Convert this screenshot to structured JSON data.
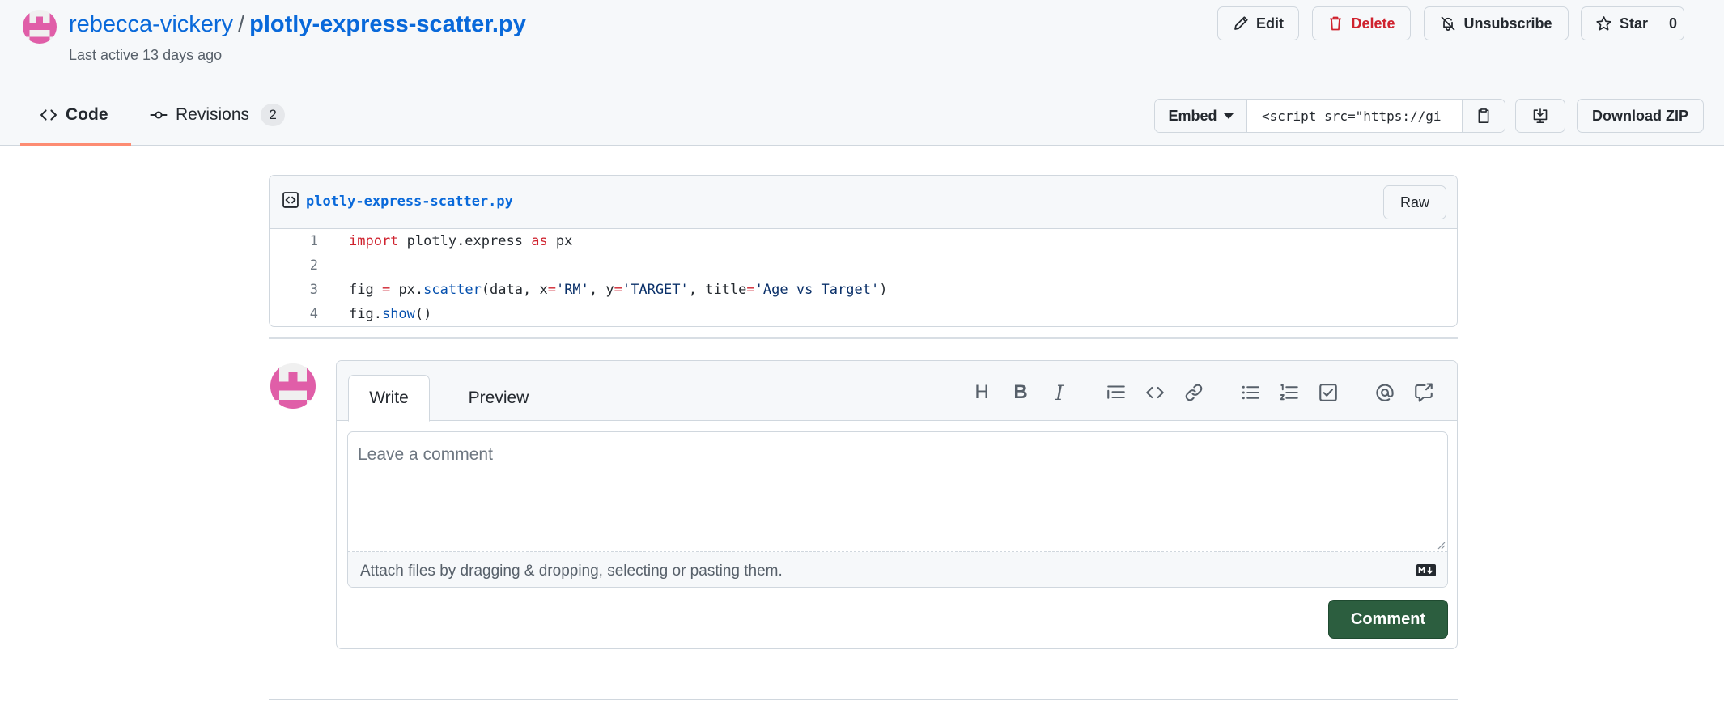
{
  "header": {
    "owner": "rebecca-vickery",
    "separator": "/",
    "gist_name": "plotly-express-scatter.py",
    "last_active": "Last active 13 days ago"
  },
  "actions": {
    "edit": "Edit",
    "delete": "Delete",
    "unsubscribe": "Unsubscribe",
    "star": "Star",
    "star_count": "0"
  },
  "tabs": {
    "code": "Code",
    "revisions": "Revisions",
    "revisions_count": "2"
  },
  "embed": {
    "label": "Embed",
    "value": "<script src=\"https://gi",
    "download": "Download ZIP"
  },
  "file": {
    "name": "plotly-express-scatter.py",
    "raw": "Raw",
    "lines": [
      {
        "num": "1",
        "tokens": [
          {
            "t": "import",
            "c": "kw"
          },
          {
            "t": " plotly.express ",
            "c": ""
          },
          {
            "t": "as",
            "c": "kw"
          },
          {
            "t": " px",
            "c": ""
          }
        ]
      },
      {
        "num": "2",
        "tokens": []
      },
      {
        "num": "3",
        "tokens": [
          {
            "t": "fig ",
            "c": ""
          },
          {
            "t": "=",
            "c": "op"
          },
          {
            "t": " px.",
            "c": ""
          },
          {
            "t": "scatter",
            "c": "fn"
          },
          {
            "t": "(data, x",
            "c": ""
          },
          {
            "t": "=",
            "c": "op"
          },
          {
            "t": "'RM'",
            "c": "str"
          },
          {
            "t": ", y",
            "c": ""
          },
          {
            "t": "=",
            "c": "op"
          },
          {
            "t": "'TARGET'",
            "c": "str"
          },
          {
            "t": ", title",
            "c": ""
          },
          {
            "t": "=",
            "c": "op"
          },
          {
            "t": "'Age vs Target'",
            "c": "str"
          },
          {
            "t": ")",
            "c": ""
          }
        ]
      },
      {
        "num": "4",
        "tokens": [
          {
            "t": "fig.",
            "c": ""
          },
          {
            "t": "show",
            "c": "fn"
          },
          {
            "t": "()",
            "c": ""
          }
        ]
      }
    ]
  },
  "comment": {
    "write": "Write",
    "preview": "Preview",
    "placeholder": "Leave a comment",
    "attach": "Attach files by dragging & dropping, selecting or pasting them.",
    "submit": "Comment",
    "toolbar": {
      "heading": "H",
      "bold": "B",
      "italic": "I"
    }
  },
  "colors": {
    "link": "#0969da",
    "delete": "#cf222e",
    "comment_button": "#2c5e3f",
    "avatar": "#e05ea8",
    "tab_underline": "#fd8c73"
  }
}
